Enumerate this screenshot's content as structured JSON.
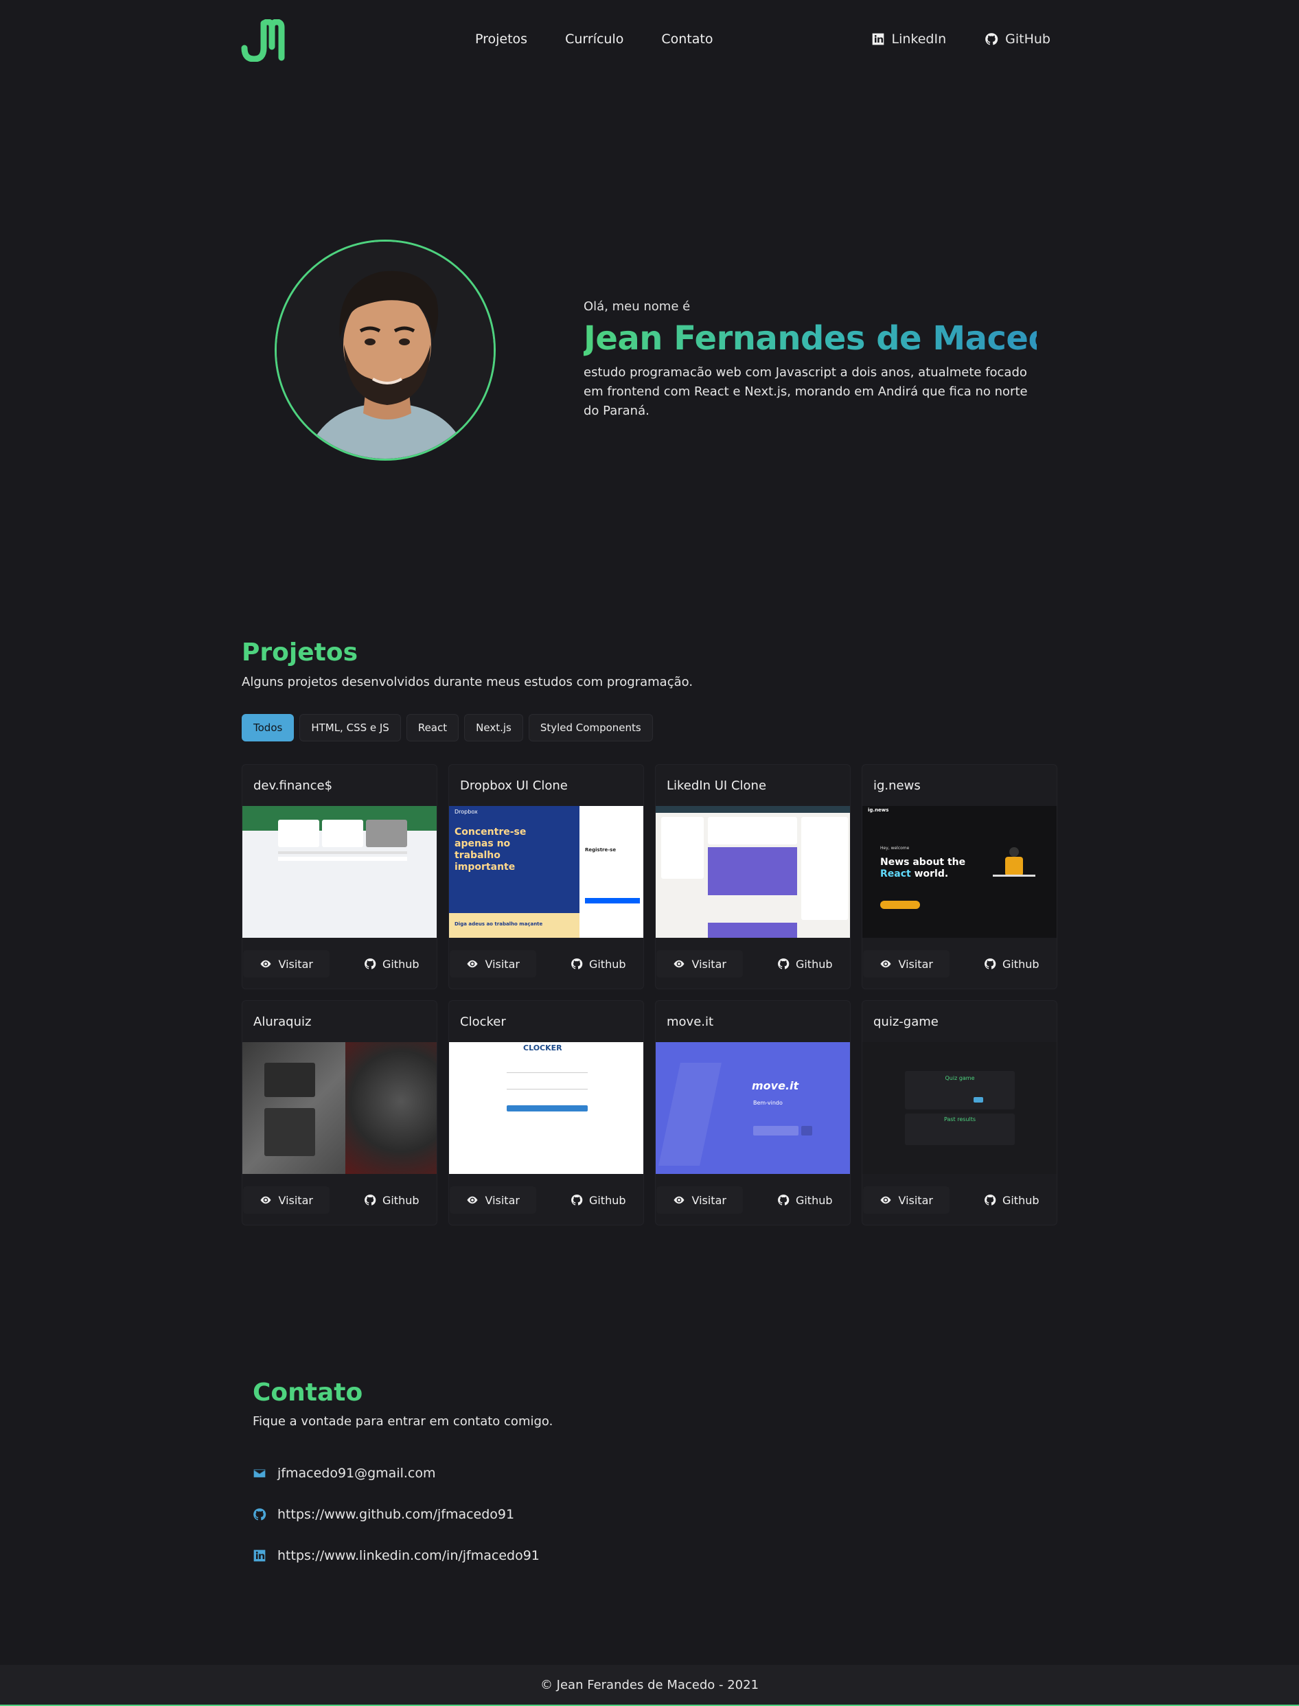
{
  "header": {
    "logo_text": "JM",
    "nav": [
      "Projetos",
      "Currículo",
      "Contato"
    ],
    "social": [
      {
        "label": "LinkedIn",
        "icon": "linkedin-icon"
      },
      {
        "label": "GitHub",
        "icon": "github-icon"
      }
    ]
  },
  "hero": {
    "greeting": "Olá, meu nome é",
    "name": "Jean Fernandes de Macedo",
    "description": "estudo programacão web com Javascript a dois anos, atualmete focado em frontend com React e Next.js, morando em Andirá que fica no norte do Paraná."
  },
  "projects": {
    "title": "Projetos",
    "subtitle": "Alguns projetos desenvolvidos durante meus estudos com programação.",
    "filters": [
      "Todos",
      "HTML, CSS e JS",
      "React",
      "Next.js",
      "Styled Components"
    ],
    "active_filter": "Todos",
    "visit_label": "Visitar",
    "github_label": "Github",
    "cards": [
      {
        "title": "dev.finance$"
      },
      {
        "title": "Dropbox UI Clone"
      },
      {
        "title": "LikedIn UI Clone"
      },
      {
        "title": "ig.news"
      },
      {
        "title": "Aluraquiz"
      },
      {
        "title": "Clocker"
      },
      {
        "title": "move.it"
      },
      {
        "title": "quiz-game"
      }
    ],
    "thumb_text": {
      "dropbox_brand": "Dropbox",
      "dropbox_headline": "Concentre-se apenas no trabalho importante",
      "dropbox_footer": "Diga adeus ao trabalho maçante",
      "dropbox_signup": "Registre-se",
      "ignews_brand": "ig.news",
      "ignews_welcome": "Hey, welcome",
      "ignews_line1": "News about the",
      "ignews_accent": "React",
      "ignews_line2": "world.",
      "clocker_brand": "CLOCKER",
      "moveit_brand": "move.it",
      "moveit_welcome": "Bem-vindo",
      "quiz_title": "Quiz game",
      "quiz_results": "Past results"
    }
  },
  "contact": {
    "title": "Contato",
    "subtitle": "Fique a vontade para entrar em contato comigo.",
    "items": [
      {
        "icon": "mail-icon",
        "text": "jfmacedo91@gmail.com"
      },
      {
        "icon": "github-icon",
        "text": "https://www.github.com/jfmacedo91"
      },
      {
        "icon": "linkedin-icon",
        "text": "https://www.linkedin.com/in/jfmacedo91"
      }
    ]
  },
  "footer": {
    "text": "© Jean Ferandes de Macedo - 2021"
  },
  "colors": {
    "background": "#19191d",
    "accent_green": "#4ed37f",
    "accent_blue": "#4aa6d8",
    "card": "#1c1c20"
  }
}
